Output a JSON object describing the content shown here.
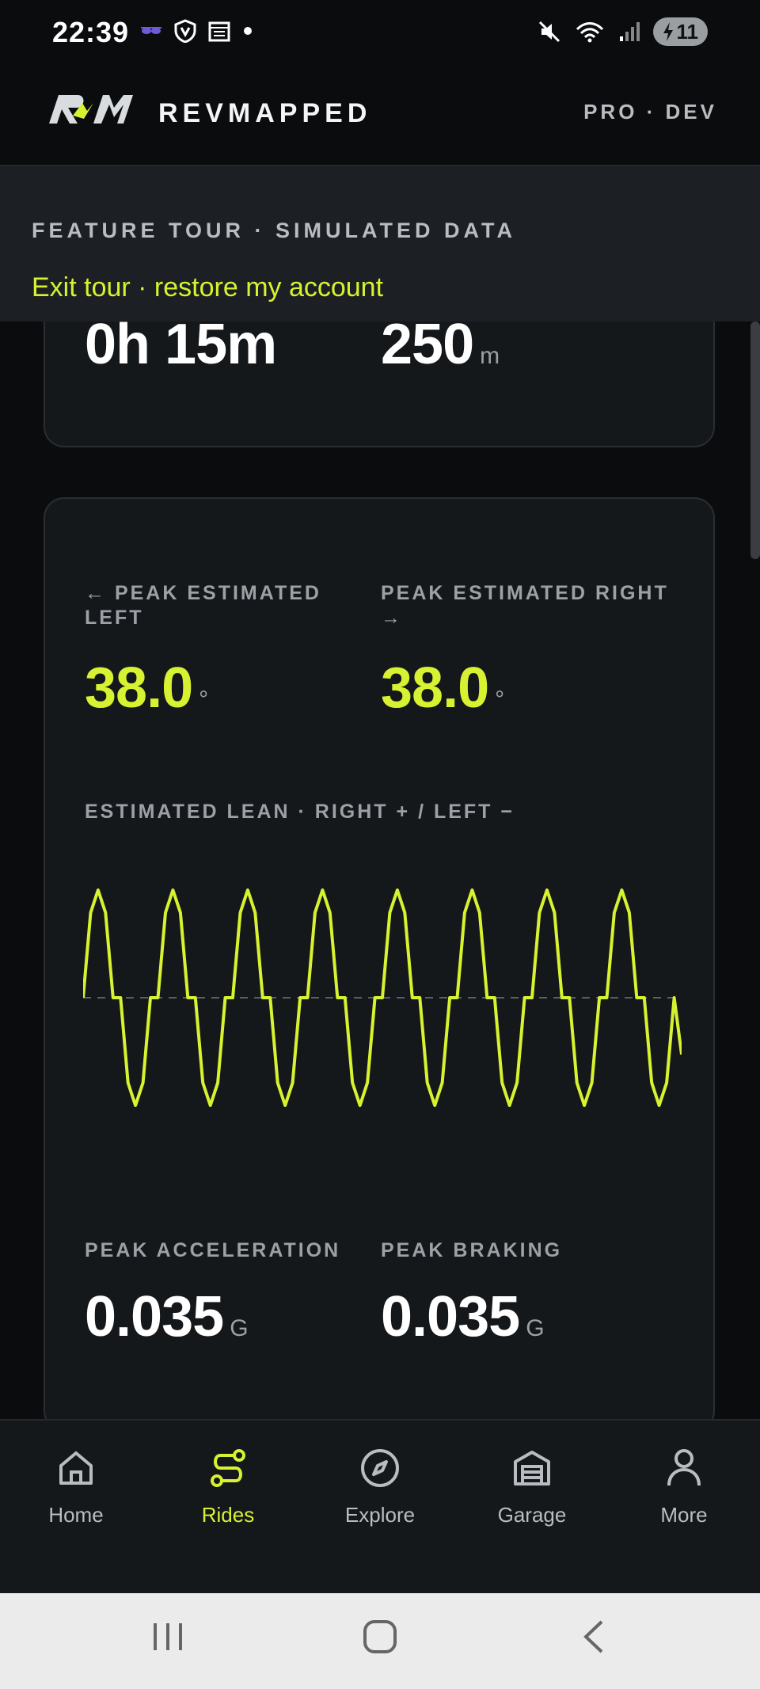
{
  "status_bar": {
    "time": "22:39",
    "left_icons": [
      "glasses-icon",
      "shield-v-icon",
      "calendar-icon",
      "dot-icon"
    ],
    "right_icons": [
      "mute-icon",
      "wifi-icon",
      "signal-icon"
    ],
    "battery": "11"
  },
  "app_bar": {
    "brand": "REVMAPPED",
    "plan": "PRO · DEV"
  },
  "tour_banner": {
    "title": "FEATURE TOUR · SIMULATED DATA",
    "link": "Exit tour · restore my account"
  },
  "summary_card": {
    "duration": "0h 15m",
    "elevation_value": "250",
    "elevation_unit": "m"
  },
  "lean_card": {
    "peak_left_label": "← PEAK ESTIMATED LEFT",
    "peak_left_value": "38.0",
    "peak_right_label": "PEAK ESTIMATED RIGHT →",
    "peak_right_value": "38.0",
    "degree_unit": "°",
    "chart_label": "ESTIMATED LEAN · RIGHT + / LEFT −",
    "peak_accel_label": "PEAK ACCELERATION",
    "peak_accel_value": "0.035",
    "peak_brake_label": "PEAK BRAKING",
    "peak_brake_value": "0.035",
    "g_unit": "G"
  },
  "chart_data": {
    "type": "line",
    "series": [
      {
        "values": [
          0,
          30,
          38,
          30,
          0,
          0,
          -30,
          -38,
          -30,
          0,
          0,
          30,
          38,
          30,
          0,
          0,
          -30,
          -38,
          -30,
          0,
          0,
          30,
          38,
          30,
          0,
          0,
          -30,
          -38,
          -30,
          0,
          0,
          30,
          38,
          30,
          0,
          0,
          -30,
          -38,
          -30,
          0,
          0,
          30,
          38,
          30,
          0,
          0,
          -30,
          -38,
          -30,
          0,
          0,
          30,
          38,
          30,
          0,
          0,
          -30,
          -38,
          -30,
          0,
          0,
          30,
          38,
          30,
          0,
          0,
          -30,
          -38,
          -30,
          0,
          0,
          30,
          38,
          30,
          0,
          0,
          -30,
          -38,
          -30,
          0,
          -20
        ]
      }
    ],
    "ylim": [
      -38,
      38
    ],
    "zero_line": true,
    "color": "#d6f230"
  },
  "nav": {
    "items": [
      {
        "label": "Home",
        "icon": "home-icon"
      },
      {
        "label": "Rides",
        "icon": "rides-icon",
        "active": true
      },
      {
        "label": "Explore",
        "icon": "compass-icon"
      },
      {
        "label": "Garage",
        "icon": "garage-icon"
      },
      {
        "label": "More",
        "icon": "person-icon"
      }
    ]
  },
  "system_nav": [
    "recents-icon",
    "home-circle-icon",
    "back-icon"
  ]
}
